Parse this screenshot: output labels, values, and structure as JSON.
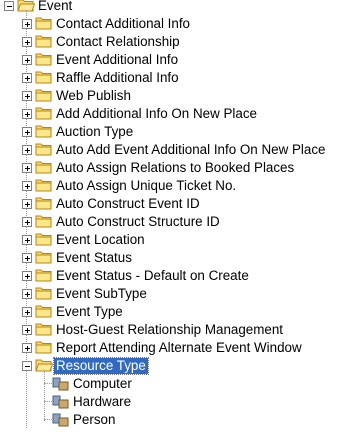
{
  "tree": {
    "root": {
      "label": "Event",
      "expanded": true,
      "icon": "folder-open-icon",
      "children": [
        {
          "label": "Contact Additional Info",
          "expanded": false
        },
        {
          "label": "Contact Relationship",
          "expanded": false
        },
        {
          "label": "Event Additional Info",
          "expanded": false
        },
        {
          "label": "Raffle Additional Info",
          "expanded": false
        },
        {
          "label": "Web Publish",
          "expanded": false
        },
        {
          "label": "Add Additional Info On New Place",
          "expanded": false
        },
        {
          "label": "Auction Type",
          "expanded": false
        },
        {
          "label": "Auto Add Event Additional Info On New Place",
          "expanded": false
        },
        {
          "label": "Auto Assign Relations to Booked Places",
          "expanded": false
        },
        {
          "label": "Auto Assign Unique Ticket No.",
          "expanded": false
        },
        {
          "label": "Auto Construct Event ID",
          "expanded": false
        },
        {
          "label": "Auto Construct Structure ID",
          "expanded": false
        },
        {
          "label": "Event Location",
          "expanded": false
        },
        {
          "label": "Event Status",
          "expanded": false
        },
        {
          "label": "Event Status - Default on Create",
          "expanded": false
        },
        {
          "label": "Event SubType",
          "expanded": false
        },
        {
          "label": "Event Type",
          "expanded": false
        },
        {
          "label": "Host-Guest Relationship Management",
          "expanded": false
        },
        {
          "label": "Report Attending Alternate Event Window",
          "expanded": false
        },
        {
          "label": "Resource Type",
          "expanded": true,
          "selected": true,
          "children": [
            {
              "label": "Computer",
              "icon": "resource-node-icon"
            },
            {
              "label": "Hardware",
              "icon": "resource-node-icon"
            },
            {
              "label": "Person",
              "icon": "resource-node-icon"
            }
          ]
        }
      ]
    }
  },
  "colors": {
    "folder_fill": "#f7dc6f",
    "folder_stroke": "#b8860b",
    "selection": "#316ac5"
  }
}
